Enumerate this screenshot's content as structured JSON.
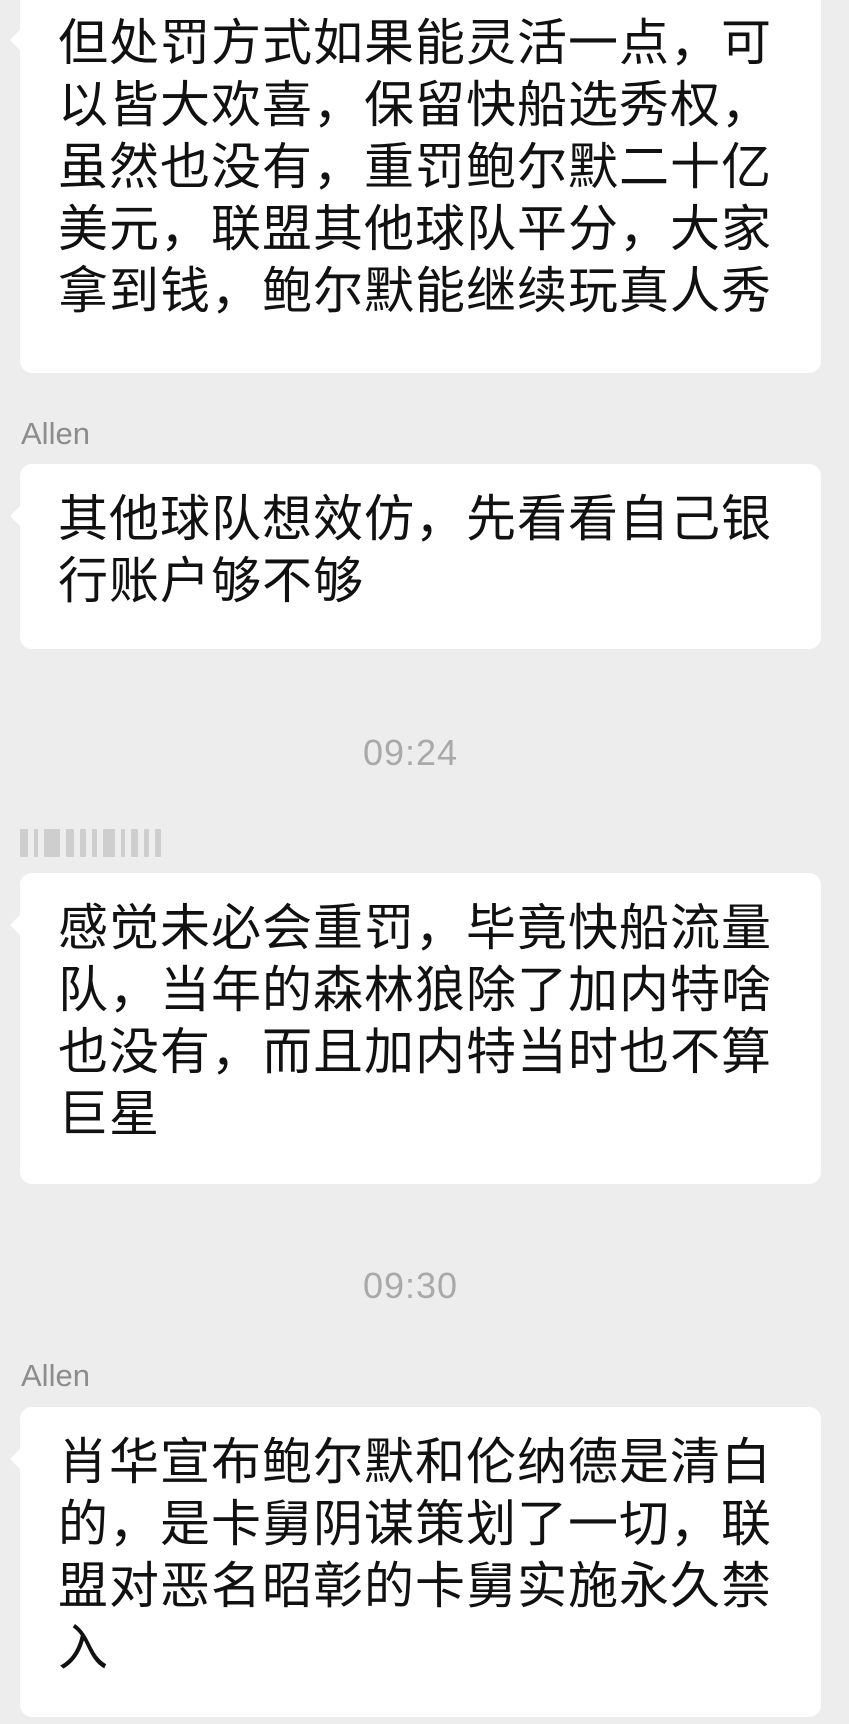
{
  "messages": [
    {
      "text": "但处罚方式如果能灵活一点，可以皆大欢喜，保留快船选秀权，虽然也没有，重罚鲍尔默二十亿美元，联盟其他球队平分，大家拿到钱，鲍尔默能继续玩真人秀"
    },
    {
      "sender": "Allen",
      "text": "其他球队想效仿，先看看自己银行账户够不够"
    },
    {
      "time": "09:24"
    },
    {
      "text": "感觉未必会重罚，毕竟快船流量队，当年的森林狼除了加内特啥也没有，而且加内特当时也不算巨星"
    },
    {
      "time": "09:30"
    },
    {
      "sender": "Allen",
      "text": "肖华宣布鲍尔默和伦纳德是清白的，是卡舅阴谋策划了一切，联盟对恶名昭彰的卡舅实施永久禁入"
    }
  ]
}
